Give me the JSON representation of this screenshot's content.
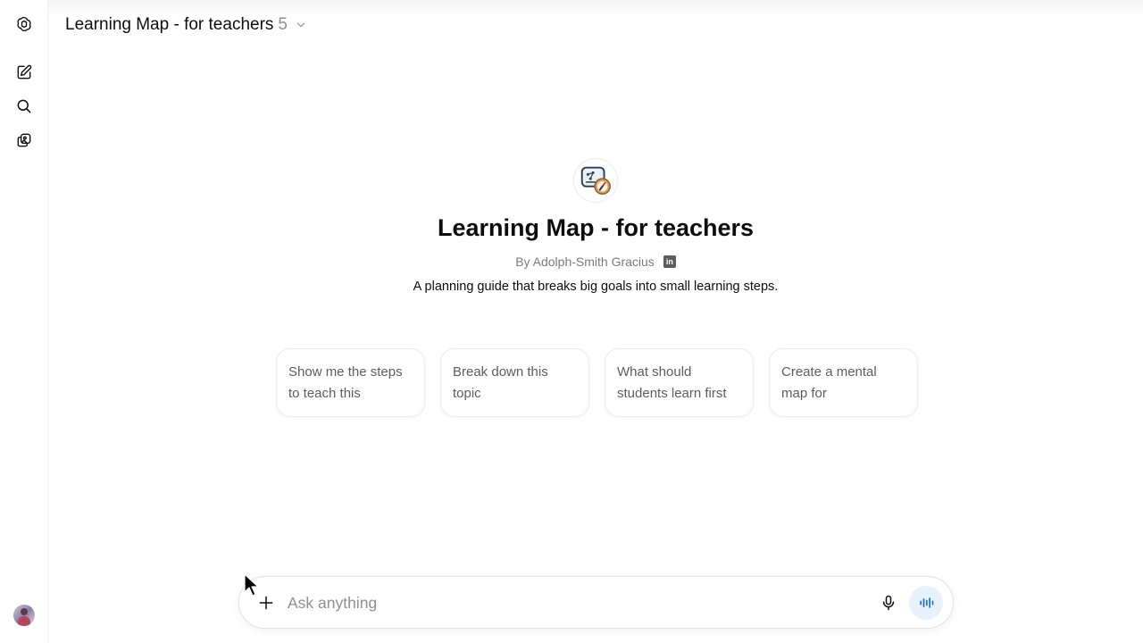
{
  "header": {
    "title": "Learning Map - for teachers",
    "version_count": "5"
  },
  "sidebar": {
    "items": [
      {
        "name": "openai-logo-icon"
      },
      {
        "name": "new-chat-icon"
      },
      {
        "name": "search-icon"
      },
      {
        "name": "library-icon"
      }
    ]
  },
  "gpt": {
    "name": "Learning Map - for teachers",
    "byline": "By Adolph-Smith Gracius",
    "linkedin_label": "in",
    "description": "A planning guide that breaks big goals into small learning steps."
  },
  "starters": [
    {
      "label": "Show me the steps to teach this"
    },
    {
      "label": "Break down this topic"
    },
    {
      "label": "What should students learn first"
    },
    {
      "label": "Create a mental map for"
    }
  ],
  "composer": {
    "placeholder": "Ask anything",
    "value": ""
  },
  "colors": {
    "accent": "#e6f1fb",
    "text": "#0d0d0d",
    "muted": "#8f8f8f"
  }
}
